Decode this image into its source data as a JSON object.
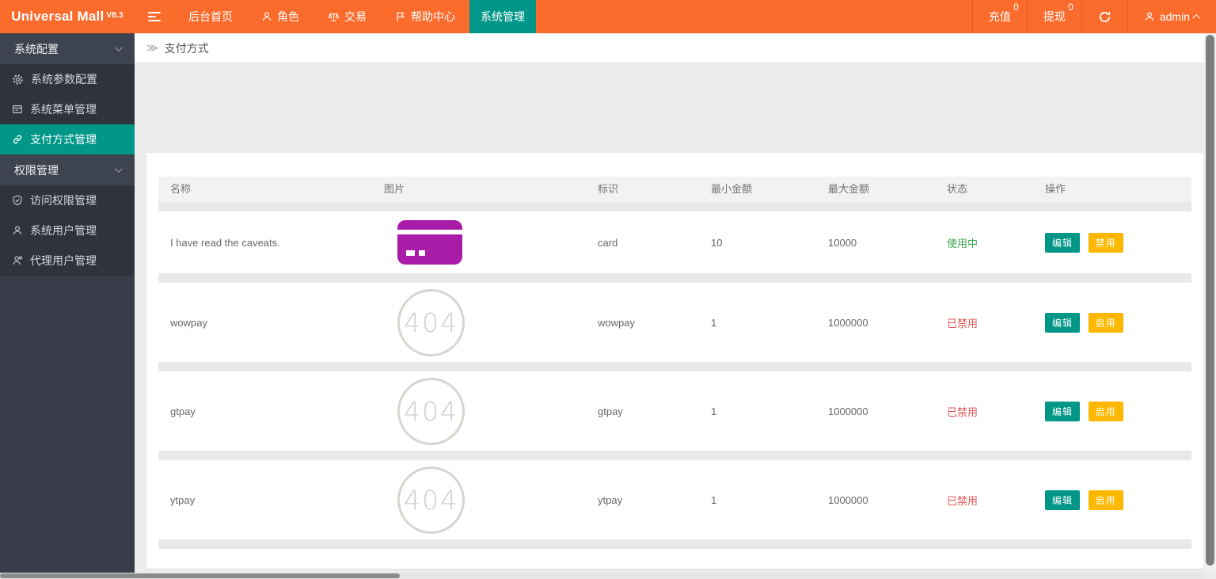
{
  "header": {
    "logo": "Universal Mall",
    "version": "V8.3",
    "nav": [
      {
        "label": "后台首页"
      },
      {
        "label": "角色",
        "icon": "user-icon"
      },
      {
        "label": "交易",
        "icon": "scales-icon"
      },
      {
        "label": "帮助中心",
        "icon": "flag-icon"
      },
      {
        "label": "系统管理",
        "active": true
      }
    ],
    "right": {
      "recharge": {
        "label": "充值",
        "badge": "0"
      },
      "withdraw": {
        "label": "提现",
        "badge": "0"
      },
      "refresh": {
        "icon": "refresh-icon"
      },
      "user": {
        "label": "admin",
        "icon": "user-icon"
      }
    }
  },
  "sidebar": {
    "groups": [
      {
        "label": "系统配置",
        "items": [
          {
            "label": "系统参数配置",
            "icon": "gear-icon"
          },
          {
            "label": "系统菜单管理",
            "icon": "menu-window-icon"
          },
          {
            "label": "支付方式管理",
            "icon": "link-icon",
            "active": true
          }
        ]
      },
      {
        "label": "权限管理",
        "items": [
          {
            "label": "访问权限管理",
            "icon": "shield-check-icon"
          },
          {
            "label": "系统用户管理",
            "icon": "user-icon"
          },
          {
            "label": "代理用户管理",
            "icon": "agent-user-icon"
          }
        ]
      }
    ]
  },
  "breadcrumb": {
    "icon": "≫",
    "label": "支付方式"
  },
  "payment_table": {
    "columns": [
      "名称",
      "图片",
      "标识",
      "最小金额",
      "最大金额",
      "状态",
      "操作"
    ],
    "placeholder_text": "404",
    "colors": {
      "accent_orange": "#fb6b2c",
      "accent_teal": "#009688",
      "button_yellow": "#ffb800",
      "status_green": "#3aa54d",
      "status_red": "#e25454",
      "card_purple": "#a81ca8"
    },
    "rows": [
      {
        "name": "I have read the caveats.",
        "image": "card-image",
        "identifier": "card",
        "min_amount": "10",
        "max_amount": "10000",
        "status": "使用中",
        "status_type": "active",
        "actions": [
          "编辑",
          "禁用"
        ]
      },
      {
        "name": "wowpay",
        "image": "404-placeholder",
        "identifier": "wowpay",
        "min_amount": "1",
        "max_amount": "1000000",
        "status": "已禁用",
        "status_type": "disabled",
        "actions": [
          "编辑",
          "启用"
        ]
      },
      {
        "name": "gtpay",
        "image": "404-placeholder",
        "identifier": "gtpay",
        "min_amount": "1",
        "max_amount": "1000000",
        "status": "已禁用",
        "status_type": "disabled",
        "actions": [
          "编辑",
          "启用"
        ]
      },
      {
        "name": "ytpay",
        "image": "404-placeholder",
        "identifier": "ytpay",
        "min_amount": "1",
        "max_amount": "1000000",
        "status": "已禁用",
        "status_type": "disabled",
        "actions": [
          "编辑",
          "启用"
        ]
      }
    ]
  }
}
